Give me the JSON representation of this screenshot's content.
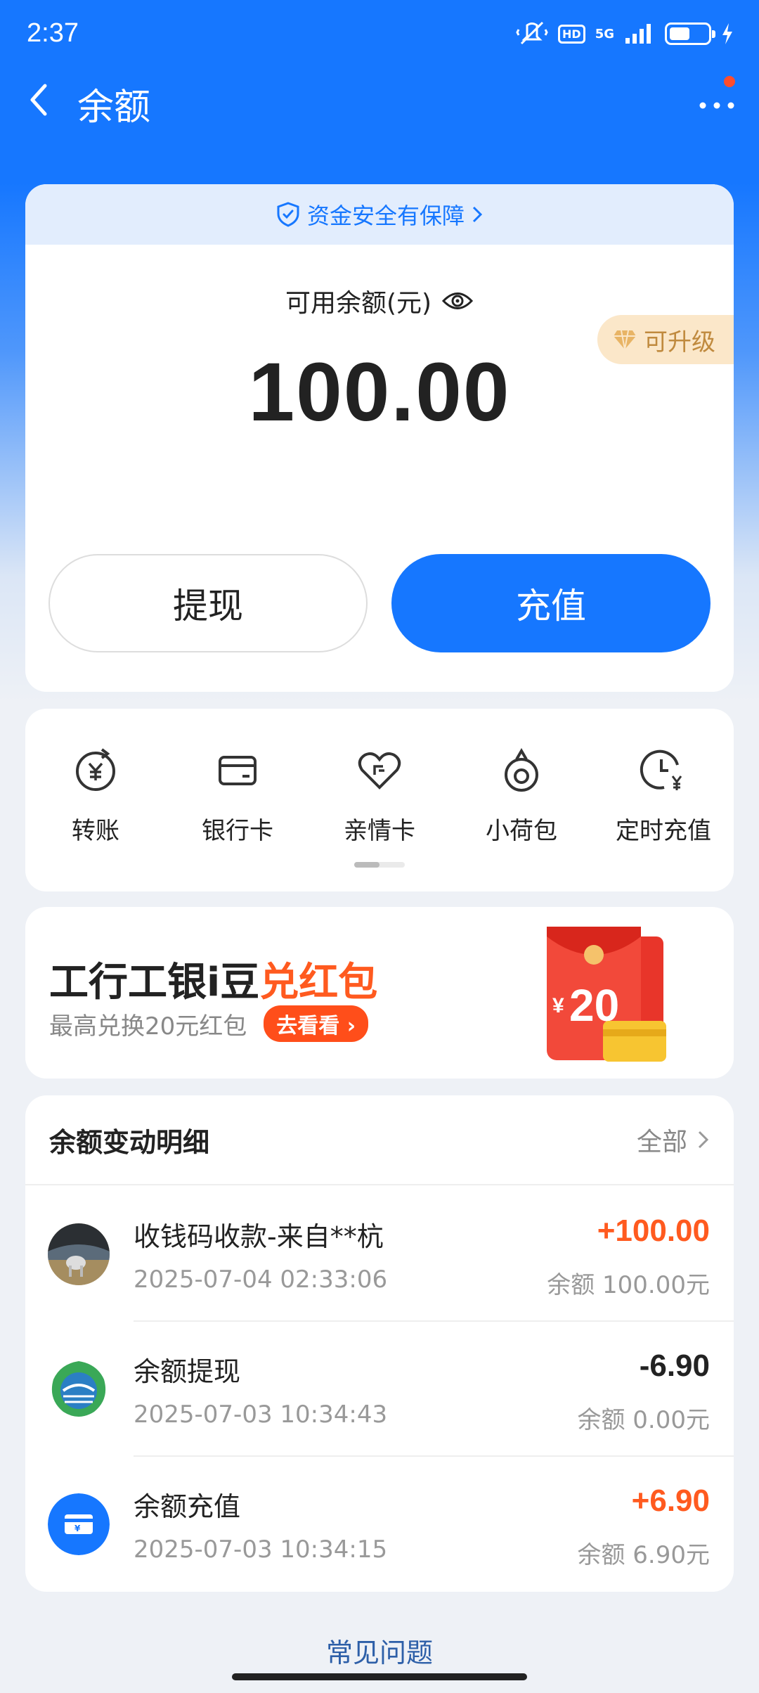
{
  "status_bar": {
    "time": "2:37",
    "network": "5G",
    "hd_label": "HD"
  },
  "nav": {
    "title": "余额"
  },
  "balance": {
    "safety_text": "资金安全有保障",
    "available_label": "可用余额(元)",
    "amount": "100.00",
    "upgrade_label": "可升级",
    "withdraw_label": "提现",
    "recharge_label": "充值"
  },
  "services": [
    {
      "label": "转账",
      "icon": "transfer-icon"
    },
    {
      "label": "银行卡",
      "icon": "bank-card-icon"
    },
    {
      "label": "亲情卡",
      "icon": "family-card-icon"
    },
    {
      "label": "小荷包",
      "icon": "purse-icon"
    },
    {
      "label": "定时充值",
      "icon": "scheduled-recharge-icon"
    }
  ],
  "promo": {
    "title_main": "工行工银i豆",
    "title_highlight": "兑红包",
    "subtitle": "最高兑换20元红包",
    "button_label": "去看看",
    "art_amount": "20",
    "art_currency": "¥"
  },
  "details": {
    "title": "余额变动明细",
    "all_label": "全部",
    "rows": [
      {
        "title": "收钱码收款-来自**杭",
        "time": "2025-07-04 02:33:06",
        "amount": "+100.00",
        "balance": "余额 100.00元",
        "sign": "pos"
      },
      {
        "title": "余额提现",
        "time": "2025-07-03 10:34:43",
        "amount": "-6.90",
        "balance": "余额 0.00元",
        "sign": "neg"
      },
      {
        "title": "余额充值",
        "time": "2025-07-03 10:34:15",
        "amount": "+6.90",
        "balance": "余额 6.90元",
        "sign": "pos"
      }
    ]
  },
  "faq_label": "常见问题",
  "colors": {
    "primary": "#1677ff",
    "positive": "#ff5a1f",
    "upgrade_bg": "#fbe7c9"
  }
}
